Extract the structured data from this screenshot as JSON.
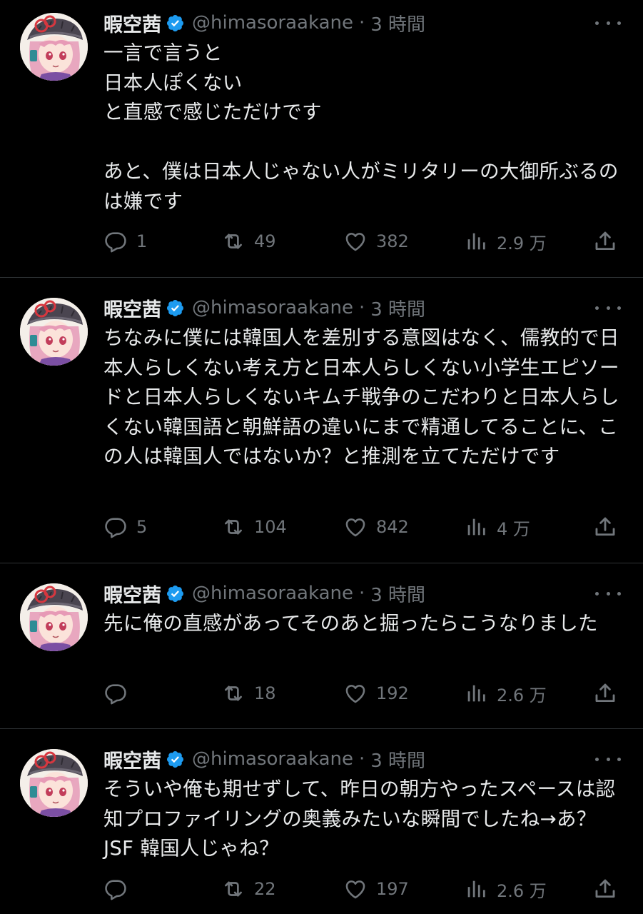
{
  "colors": {
    "background": "#000000",
    "text": "#e7e9ea",
    "muted": "#71767b",
    "verified": "#1d9bf0",
    "divider": "#2f3336"
  },
  "tweets": [
    {
      "name": "暇空茜",
      "handle": "@himasoraakane",
      "dot": "·",
      "time": "3 時間",
      "text": "一言で言うと\n日本人ぽくない\nと直感で感じただけです\n\nあと、僕は日本人じゃない人がミリタリーの大御所ぶるのは嫌です",
      "replies": "1",
      "retweets": "49",
      "likes": "382",
      "views": "2.9 万"
    },
    {
      "name": "暇空茜",
      "handle": "@himasoraakane",
      "dot": "·",
      "time": "3 時間",
      "text": "ちなみに僕には韓国人を差別する意図はなく、儒教的で日本人らしくない考え方と日本人らしくない小学生エピソードと日本人らしくないキムチ戦争のこだわりと日本人らしくない韓国語と朝鮮語の違いにまで精通してることに、この人は韓国人ではないか？と推測を立てただけです",
      "replies": "5",
      "retweets": "104",
      "likes": "842",
      "views": "4 万"
    },
    {
      "name": "暇空茜",
      "handle": "@himasoraakane",
      "dot": "·",
      "time": "3 時間",
      "text": "先に俺の直感があってそのあと掘ったらこうなりました",
      "replies": "",
      "retweets": "18",
      "likes": "192",
      "views": "2.6 万"
    },
    {
      "name": "暇空茜",
      "handle": "@himasoraakane",
      "dot": "·",
      "time": "3 時間",
      "text": "そういや俺も期せずして、昨日の朝方やったスペースは認知プロファイリングの奥義みたいな瞬間でしたね→あ？JSF 韓国人じゃね？",
      "replies": "",
      "retweets": "22",
      "likes": "197",
      "views": "2.6 万"
    }
  ],
  "icons": {
    "reply": "reply-icon",
    "retweet": "retweet-icon",
    "like": "heart-icon",
    "views": "views-icon",
    "share": "share-icon",
    "more": "more-icon",
    "verified": "verified-badge-icon"
  }
}
